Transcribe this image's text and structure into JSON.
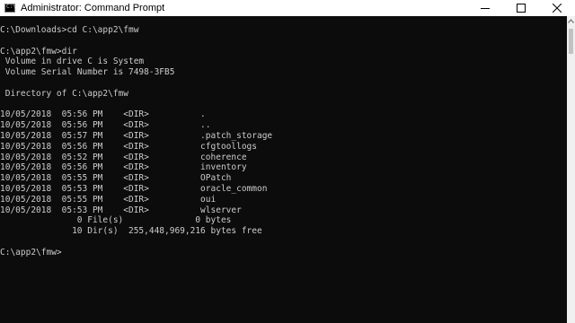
{
  "window": {
    "title": "Administrator: Command Prompt",
    "icon_label": "C:\\"
  },
  "console": {
    "lines": [
      "C:\\Downloads>cd C:\\app2\\fmw",
      "",
      "C:\\app2\\fmw>dir",
      " Volume in drive C is System",
      " Volume Serial Number is 7498-3FB5",
      "",
      " Directory of C:\\app2\\fmw",
      "",
      "10/05/2018  05:56 PM    <DIR>          .",
      "10/05/2018  05:56 PM    <DIR>          ..",
      "10/05/2018  05:57 PM    <DIR>          .patch_storage",
      "10/05/2018  05:56 PM    <DIR>          cfgtoollogs",
      "10/05/2018  05:52 PM    <DIR>          coherence",
      "10/05/2018  05:56 PM    <DIR>          inventory",
      "10/05/2018  05:55 PM    <DIR>          OPatch",
      "10/05/2018  05:53 PM    <DIR>          oracle_common",
      "10/05/2018  05:55 PM    <DIR>          oui",
      "10/05/2018  05:53 PM    <DIR>          wlserver",
      "               0 File(s)              0 bytes",
      "              10 Dir(s)  255,448,969,216 bytes free",
      "",
      "C:\\app2\\fmw>"
    ]
  },
  "icons": {
    "minimize": "minimize-icon",
    "maximize": "maximize-icon",
    "close": "close-icon",
    "scroll_up": "scroll-up-arrow-icon"
  },
  "colors": {
    "console_bg": "#0c0c0c",
    "console_text": "#cccccc",
    "titlebar_bg": "#ffffff"
  }
}
